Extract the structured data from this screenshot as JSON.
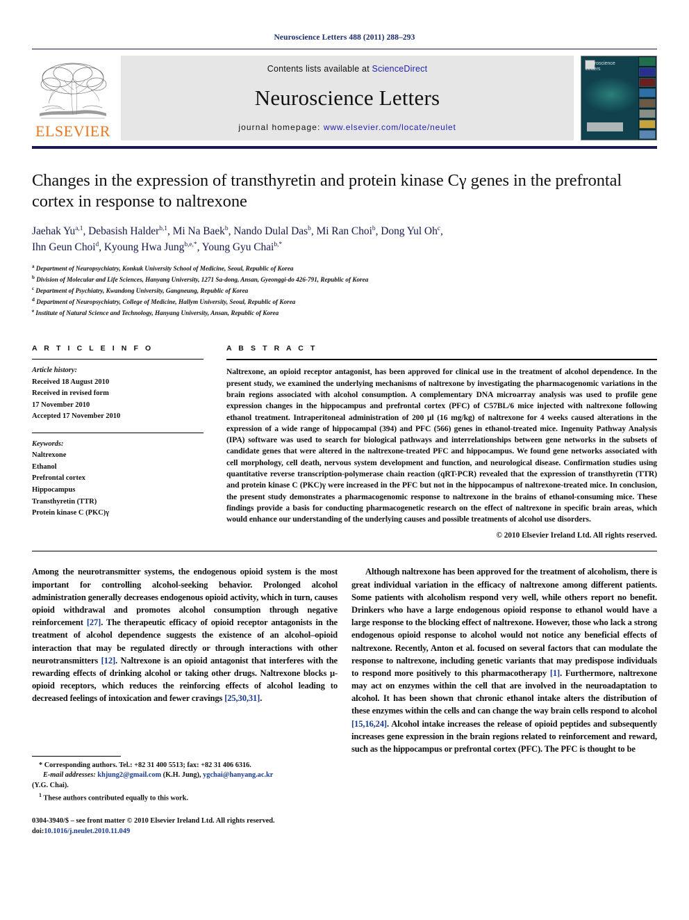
{
  "running_head": "Neuroscience Letters 488 (2011) 288–293",
  "masthead": {
    "publisher_name": "ELSEVIER",
    "contents_prefix": "Contents lists available at ",
    "contents_link": "ScienceDirect",
    "journal_title": "Neuroscience Letters",
    "homepage_prefix": "journal homepage: ",
    "homepage_url": "www.elsevier.com/locate/neulet",
    "cover_title_line1": "Neuroscience",
    "cover_title_line2": "Letters"
  },
  "article": {
    "title": "Changes in the expression of transthyretin and protein kinase Cγ genes in the prefrontal cortex in response to naltrexone",
    "authors_line1": "Jaehak Yu a,1, Debasish Halder b,1, Mi Na Baek b, Nando Dulal Das b, Mi Ran Choi b, Dong Yul Oh c,",
    "authors_line2": "Ihn Geun Choi d, Kyoung Hwa Jung b,e,*, Young Gyu Chai b,*",
    "affiliations": [
      {
        "marker": "a",
        "text": "Department of Neuropsychiatry, Konkuk University School of Medicine, Seoul, Republic of Korea"
      },
      {
        "marker": "b",
        "text": "Division of Molecular and Life Sciences, Hanyang University, 1271 Sa-dong, Ansan, Gyeonggi-do 426-791, Republic of Korea"
      },
      {
        "marker": "c",
        "text": "Department of Psychiatry, Kwandong University, Gangneung, Republic of Korea"
      },
      {
        "marker": "d",
        "text": "Department of Neuropsychiatry, College of Medicine, Hallym University, Seoul, Republic of Korea"
      },
      {
        "marker": "e",
        "text": "Institute of Natural Science and Technology, Hanyang University, Ansan, Republic of Korea"
      }
    ]
  },
  "article_info": {
    "heading": "A R T I C L E   I N F O",
    "history_label": "Article history:",
    "history_lines": [
      "Received 18 August 2010",
      "Received in revised form",
      "17 November 2010",
      "Accepted 17 November 2010"
    ],
    "keywords_label": "Keywords:",
    "keywords": [
      "Naltrexone",
      "Ethanol",
      "Prefrontal cortex",
      "Hippocampus",
      "Transthyretin (TTR)",
      "Protein kinase C (PKC)γ"
    ]
  },
  "abstract": {
    "heading": "A B S T R A C T",
    "text": "Naltrexone, an opioid receptor antagonist, has been approved for clinical use in the treatment of alcohol dependence. In the present study, we examined the underlying mechanisms of naltrexone by investigating the pharmacogenomic variations in the brain regions associated with alcohol consumption. A complementary DNA microarray analysis was used to profile gene expression changes in the hippocampus and prefrontal cortex (PFC) of C57BL/6 mice injected with naltrexone following ethanol treatment. Intraperitoneal administration of 200 μl (16 mg/kg) of naltrexone for 4 weeks caused alterations in the expression of a wide range of hippocampal (394) and PFC (566) genes in ethanol-treated mice. Ingenuity Pathway Analysis (IPA) software was used to search for biological pathways and interrelationships between gene networks in the subsets of candidate genes that were altered in the naltrexone-treated PFC and hippocampus. We found gene networks associated with cell morphology, cell death, nervous system development and function, and neurological disease. Confirmation studies using quantitative reverse transcription-polymerase chain reaction (qRT-PCR) revealed that the expression of transthyretin (TTR) and protein kinase C (PKC)γ were increased in the PFC but not in the hippocampus of naltrexone-treated mice. In conclusion, the present study demonstrates a pharmacogenomic response to naltrexone in the brains of ethanol-consuming mice. These findings provide a basis for conducting pharmacogenetic research on the effect of naltrexone in specific brain areas, which would enhance our understanding of the underlying causes and possible treatments of alcohol use disorders.",
    "copyright": "© 2010 Elsevier Ireland Ltd. All rights reserved."
  },
  "body": {
    "left_column": "Among the neurotransmitter systems, the endogenous opioid system is the most important for controlling alcohol-seeking behavior. Prolonged alcohol administration generally decreases endogenous opioid activity, which in turn, causes opioid withdrawal and promotes alcohol consumption through negative reinforcement [27]. The therapeutic efficacy of opioid receptor antagonists in the treatment of alcohol dependence suggests the existence of an alcohol–opioid interaction that may be regulated directly or through interactions with other neurotransmitters [12]. Naltrexone is an opioid antagonist that interferes with the rewarding effects of drinking alcohol or taking other drugs. Naltrexone blocks μ-opioid receptors, which reduces the reinforcing effects of alcohol leading to decreased feelings of intoxication and fewer cravings [25,30,31].",
    "right_column": "Although naltrexone has been approved for the treatment of alcoholism, there is great individual variation in the efficacy of naltrexone among different patients. Some patients with alcoholism respond very well, while others report no benefit. Drinkers who have a large endogenous opioid response to ethanol would have a large response to the blocking effect of naltrexone. However, those who lack a strong endogenous opioid response to alcohol would not notice any beneficial effects of naltrexone. Recently, Anton et al. focused on several factors that can modulate the response to naltrexone, including genetic variants that may predispose individuals to respond more positively to this pharmacotherapy [1]. Furthermore, naltrexone may act on enzymes within the cell that are involved in the neuroadaptation to alcohol. It has been shown that chronic ethanol intake alters the distribution of these enzymes within the cells and can change the way brain cells respond to alcohol [15,16,24]. Alcohol intake increases the release of opioid peptides and subsequently increases gene expression in the brain regions related to reinforcement and reward, such as the hippocampus or prefrontal cortex (PFC). The PFC is thought to be"
  },
  "footnotes": {
    "corresponding": "* Corresponding authors. Tel.: +82 31 400 5513; fax: +82 31 406 6316.",
    "email_label": "E-mail addresses:",
    "email1": "khjung2@gmail.com",
    "email1_owner": "(K.H. Jung),",
    "email2": "ygchai@hanyang.ac.kr",
    "email2_owner": "(Y.G. Chai).",
    "equal_contrib_marker": "1",
    "equal_contrib": "These authors contributed equally to this work.",
    "imprint": "0304-3940/$ – see front matter © 2010 Elsevier Ireland Ltd. All rights reserved.",
    "doi_label": "doi:",
    "doi": "10.1016/j.neulet.2010.11.049"
  },
  "colors": {
    "link_blue": "#2222aa",
    "ref_blue": "#1a3a8f",
    "elsevier_orange": "#e87722",
    "rule_navy": "#1a1a4e",
    "band_gray": "#e6e6e6"
  }
}
